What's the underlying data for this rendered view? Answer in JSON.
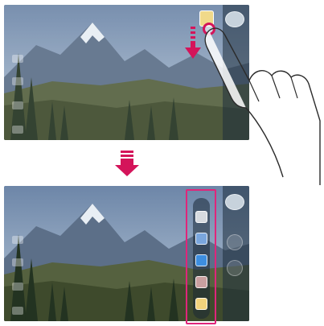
{
  "screens": [
    {
      "id": "before",
      "state": "mode-button-being-swiped-down",
      "left_icons": [
        "settings-icon",
        "flash-icon",
        "mode-icon",
        "gallery-icon"
      ],
      "edge_controls": [
        "mode-chip",
        "camera-switch",
        "shutter",
        "record",
        "gallery"
      ]
    },
    {
      "id": "after",
      "state": "mode-menu-open",
      "left_icons": [
        "settings-icon",
        "flash-icon",
        "mode-icon",
        "gallery-icon"
      ],
      "mode_menu": {
        "items": [
          {
            "icon": "manual-mode-icon",
            "color": "#d7dbe0"
          },
          {
            "icon": "panorama-icon",
            "color": "#7aa6dd"
          },
          {
            "icon": "food-mode-icon",
            "color": "#3d8ee0"
          },
          {
            "icon": "slow-motion-icon",
            "color": "#c9a0a0"
          },
          {
            "icon": "timelapse-icon",
            "color": "#f1d27c"
          }
        ]
      }
    }
  ],
  "gesture": {
    "touch_color": "#d4145a",
    "direction": "down"
  },
  "highlight": {
    "color": "#e0257a"
  }
}
